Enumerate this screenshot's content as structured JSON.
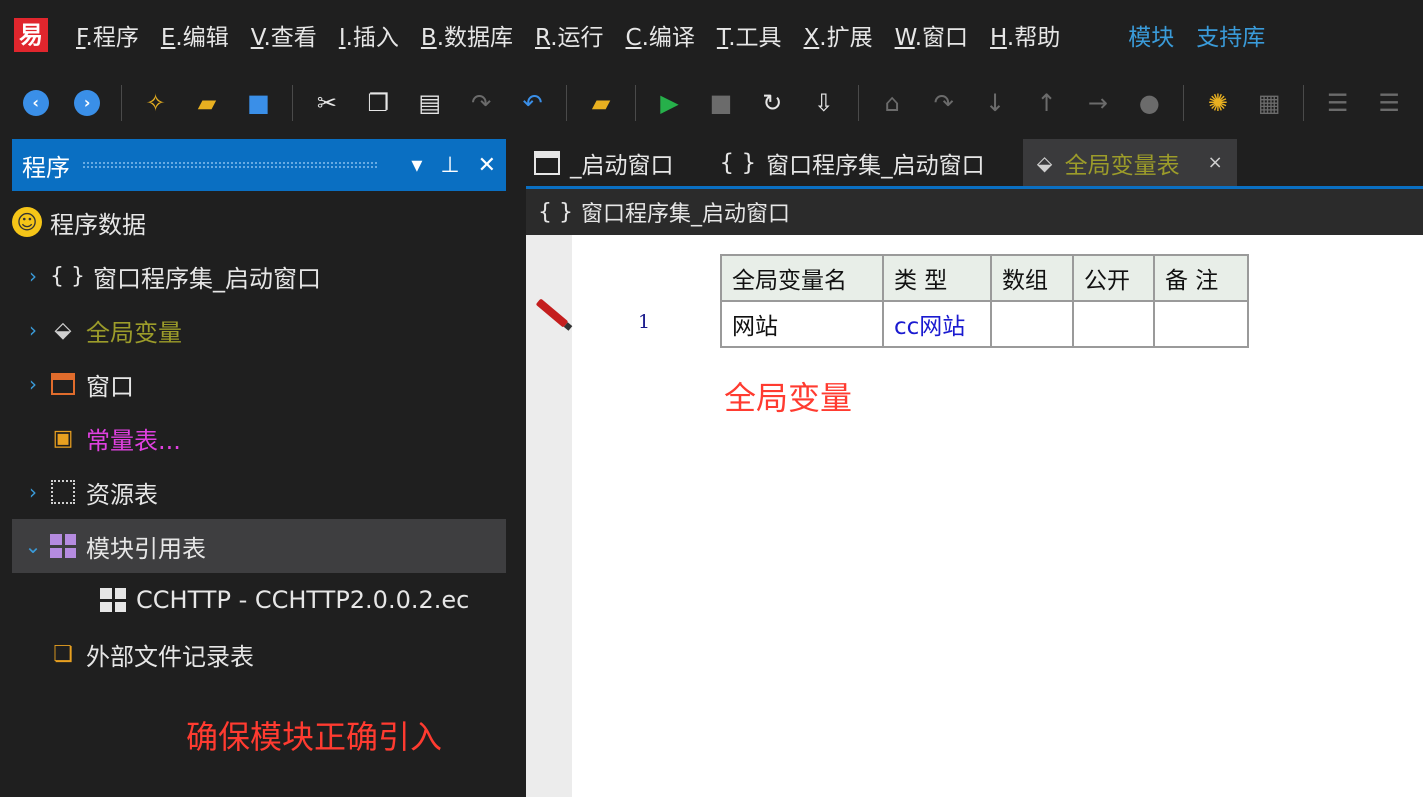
{
  "app": {
    "logo_glyph": "易"
  },
  "menu": {
    "items": [
      {
        "acc": "F",
        "label": ".程序"
      },
      {
        "acc": "E",
        "label": ".编辑"
      },
      {
        "acc": "V",
        "label": ".查看"
      },
      {
        "acc": "I",
        "label": ".插入"
      },
      {
        "acc": "B",
        "label": ".数据库"
      },
      {
        "acc": "R",
        "label": ".运行"
      },
      {
        "acc": "C",
        "label": ".编译"
      },
      {
        "acc": "T",
        "label": ".工具"
      },
      {
        "acc": "X",
        "label": ".扩展"
      },
      {
        "acc": "W",
        "label": ".窗口"
      },
      {
        "acc": "H",
        "label": ".帮助"
      }
    ],
    "links": [
      "模块",
      "支持库"
    ]
  },
  "left_panel": {
    "title": "程序",
    "dropdown_glyph": "▾",
    "pin_glyph": "📌",
    "close_glyph": "✕",
    "tree": {
      "root": "程序数据",
      "window_assembly": "窗口程序集_启动窗口",
      "global_vars": "全局变量",
      "windows": "窗口",
      "constants": "常量表...",
      "resources": "资源表",
      "module_refs": "模块引用表",
      "module_child": "CCHTTP - CCHTTP2.0.0.2.ec",
      "external_files": "外部文件记录表"
    },
    "annotation": "确保模块正确引入"
  },
  "tabs": [
    {
      "label": "_启动窗口"
    },
    {
      "label": "窗口程序集_启动窗口"
    },
    {
      "label": "全局变量表",
      "close": "×"
    }
  ],
  "breadcrumb": "窗口程序集_启动窗口",
  "editor": {
    "line_number": "1",
    "headers": [
      "全局变量名",
      "类 型",
      "数组",
      "公开",
      "备 注"
    ],
    "rows": [
      {
        "name": "网站",
        "type": "cc网站",
        "array": "",
        "public": "",
        "note": ""
      }
    ],
    "annotation": "全局变量"
  },
  "colors": {
    "panel_header": "#0a6fc2",
    "annotation_red": "#ff3b30",
    "link_blue": "#3a9bd9",
    "olive_text": "#9c9c2a",
    "pink_text": "#e040e0"
  }
}
